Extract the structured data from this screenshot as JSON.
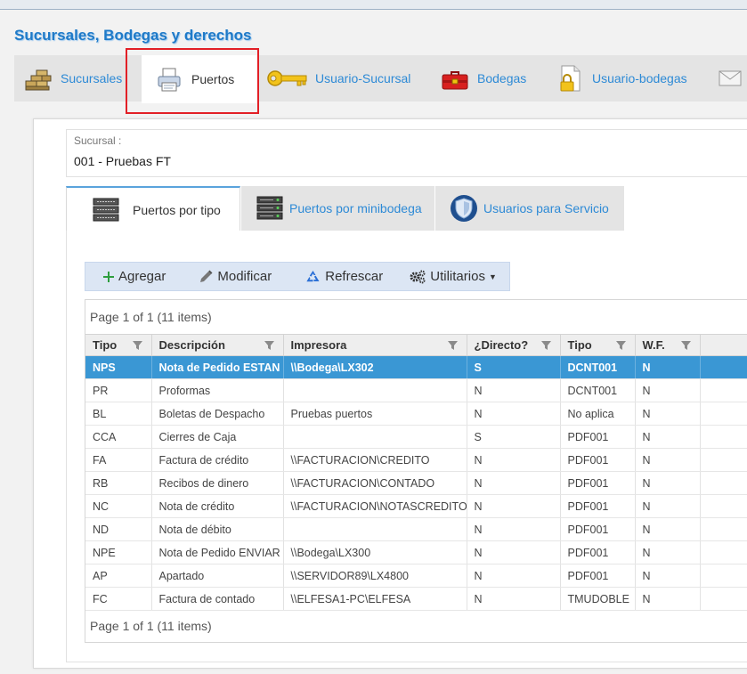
{
  "page": {
    "title": "Sucursales, Bodegas y derechos"
  },
  "main_tabs": [
    {
      "label": "Sucursales",
      "icon": "bricks-icon"
    },
    {
      "label": "Puertos",
      "icon": "printer-icon"
    },
    {
      "label": "Usuario-Sucursal",
      "icon": "key-icon"
    },
    {
      "label": "Bodegas",
      "icon": "toolbox-icon"
    },
    {
      "label": "Usuario-bodegas",
      "icon": "lock-document-icon"
    },
    {
      "label": "",
      "icon": "envelope-icon"
    }
  ],
  "sucursal": {
    "label": "Sucursal :",
    "value": "001 - Pruebas FT"
  },
  "sub_tabs": [
    {
      "label": "Puertos por tipo",
      "icon": "server-rack-icon"
    },
    {
      "label": "Puertos por minibodega",
      "icon": "server-rack-icon"
    },
    {
      "label": "Usuarios para Servicio",
      "icon": "shield-icon"
    }
  ],
  "toolbar": {
    "add": "Agregar",
    "edit": "Modificar",
    "refresh": "Refrescar",
    "utilities": "Utilitarios"
  },
  "grid": {
    "pager_top": "Page 1 of 1 (11 items)",
    "pager_bottom": "Page 1 of 1 (11 items)",
    "columns": [
      "Tipo",
      "Descripción",
      "Impresora",
      "¿Directo?",
      "Tipo",
      "W.F."
    ],
    "rows": [
      [
        "NPS",
        "Nota de Pedido ESTAN",
        "\\\\Bodega\\LX302",
        "S",
        "DCNT001",
        "N"
      ],
      [
        "PR",
        "Proformas",
        "",
        "N",
        "DCNT001",
        "N"
      ],
      [
        "BL",
        "Boletas de Despacho",
        "Pruebas puertos",
        "N",
        "No aplica",
        "N"
      ],
      [
        "CCA",
        "Cierres de Caja",
        "",
        "S",
        "PDF001",
        "N"
      ],
      [
        "FA",
        "Factura de crédito",
        "\\\\FACTURACION\\CREDITO",
        "N",
        "PDF001",
        "N"
      ],
      [
        "RB",
        "Recibos de dinero",
        "\\\\FACTURACION\\CONTADO",
        "N",
        "PDF001",
        "N"
      ],
      [
        "NC",
        "Nota de crédito",
        "\\\\FACTURACION\\NOTASCREDITO",
        "N",
        "PDF001",
        "N"
      ],
      [
        "ND",
        "Nota de débito",
        "",
        "N",
        "PDF001",
        "N"
      ],
      [
        "NPE",
        "Nota de Pedido ENVIAR",
        "\\\\Bodega\\LX300",
        "N",
        "PDF001",
        "N"
      ],
      [
        "AP",
        "Apartado",
        "\\\\SERVIDOR89\\LX4800",
        "N",
        "PDF001",
        "N"
      ],
      [
        "FC",
        "Factura de contado",
        "\\\\ELFESA1-PC\\ELFESA",
        "N",
        "TMUDOBLE",
        "N"
      ]
    ]
  },
  "colors": {
    "accent": "#2d8ad6",
    "selected_row": "#3a97d4",
    "highlight": "#e21f26"
  }
}
